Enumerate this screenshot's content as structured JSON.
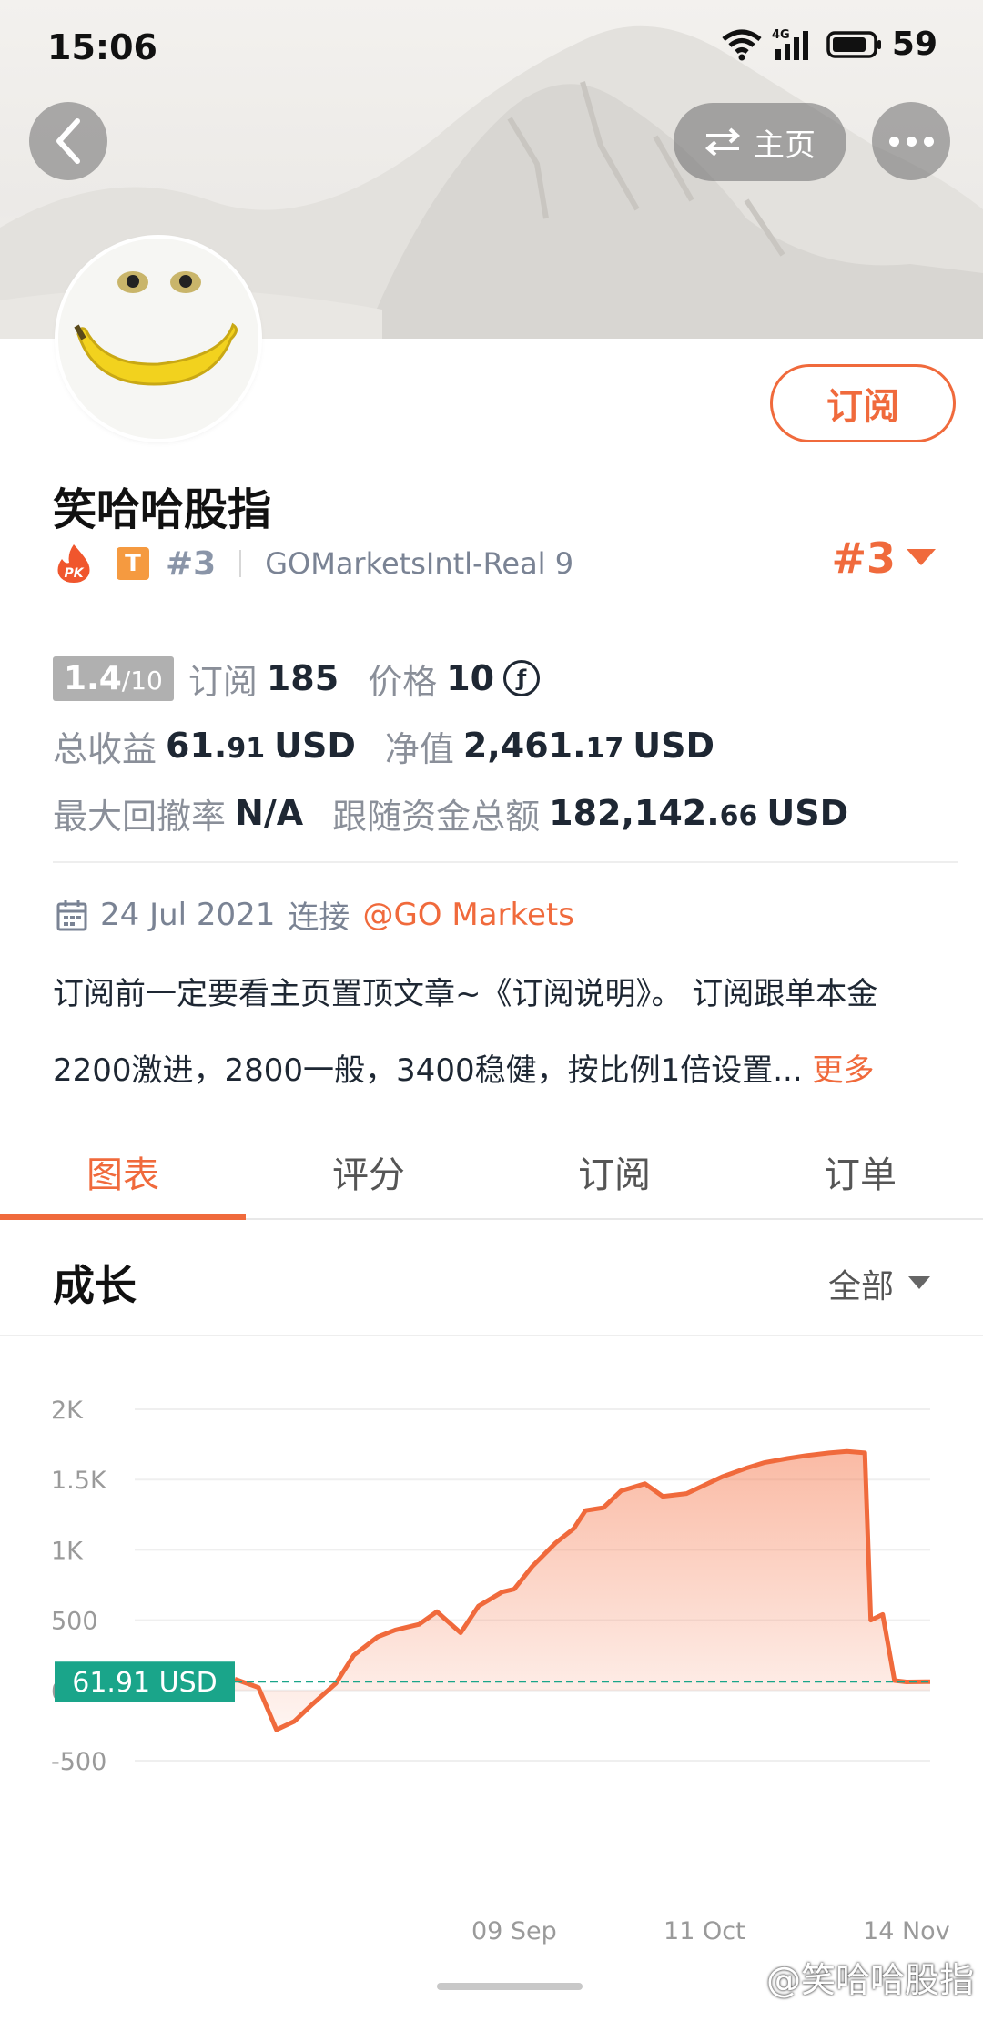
{
  "status_bar": {
    "time": "15:06",
    "network": "4G",
    "battery": "59"
  },
  "header": {
    "home_label": "主页"
  },
  "profile": {
    "name": "笑哈哈股指",
    "pk_badge": "PK",
    "type_badge": "T",
    "rank_small": "#3",
    "broker": "GOMarketsIntl-Real 9",
    "rank_big": "#3",
    "subscribe_label": "订阅"
  },
  "stats": {
    "score": "1.4",
    "score_max": "/10",
    "subscriptions_label": "订阅",
    "subscriptions_value": "185",
    "price_label": "价格",
    "price_value": "10",
    "total_profit_label": "总收益",
    "total_profit_int": "61.",
    "total_profit_dec": "91",
    "total_profit_unit": "USD",
    "net_value_label": "净值",
    "net_value_int": "2,461.",
    "net_value_dec": "17",
    "net_value_unit": "USD",
    "max_drawdown_label": "最大回撤率",
    "max_drawdown_value": "N/A",
    "follow_funds_label": "跟随资金总额",
    "follow_funds_int": "182,142.",
    "follow_funds_dec": "66",
    "follow_funds_unit": "USD"
  },
  "since": {
    "date": "24 Jul 2021",
    "connect_label": "连接",
    "broker_link": "@GO Markets"
  },
  "description": {
    "line1": "订阅前一定要看主页置顶文章~《订阅说明》。 订阅跟单本金",
    "line2": "2200激进，2800一般，3400稳健，按比例1倍设置...",
    "more_label": "更多"
  },
  "tabs": [
    {
      "label": "图表",
      "active": true
    },
    {
      "label": "评分",
      "active": false
    },
    {
      "label": "订阅",
      "active": false
    },
    {
      "label": "订单",
      "active": false
    }
  ],
  "growth": {
    "title": "成长",
    "filter_label": "全部"
  },
  "chart_data": {
    "type": "area",
    "title": "成长",
    "y_ticks": [
      "2K",
      "1.5K",
      "1K",
      "500",
      "0",
      "-500"
    ],
    "ylim": [
      -500,
      2000
    ],
    "x_ticks": [
      "09 Sep",
      "11 Oct",
      "14 Nov"
    ],
    "current_value_label": "61.91 USD",
    "current_value": 61.91,
    "series": [
      {
        "x": [
          "2021-07-24",
          "2021-07-28",
          "2021-07-31",
          "2021-08-03",
          "2021-08-06",
          "2021-08-10",
          "2021-08-13",
          "2021-08-17",
          "2021-08-20",
          "2021-08-24",
          "2021-08-27",
          "2021-08-31",
          "2021-09-03",
          "2021-09-07",
          "2021-09-09",
          "2021-09-12",
          "2021-09-16",
          "2021-09-19",
          "2021-09-21",
          "2021-09-24",
          "2021-09-27",
          "2021-10-01",
          "2021-10-04",
          "2021-10-08",
          "2021-10-11",
          "2021-10-14",
          "2021-10-18",
          "2021-10-21",
          "2021-10-25",
          "2021-10-28",
          "2021-11-01",
          "2021-11-04",
          "2021-11-07",
          "2021-11-08",
          "2021-11-09",
          "2021-11-10",
          "2021-11-12",
          "2021-11-14",
          "2021-11-18"
        ],
        "y": [
          80,
          20,
          -280,
          -220,
          -100,
          50,
          250,
          380,
          430,
          470,
          560,
          410,
          600,
          700,
          720,
          880,
          1050,
          1150,
          1280,
          1300,
          1420,
          1470,
          1380,
          1400,
          1460,
          1520,
          1580,
          1620,
          1650,
          1670,
          1690,
          1700,
          1690,
          500,
          520,
          540,
          70,
          60,
          62
        ]
      }
    ]
  },
  "watermark": "@笑哈哈股指"
}
